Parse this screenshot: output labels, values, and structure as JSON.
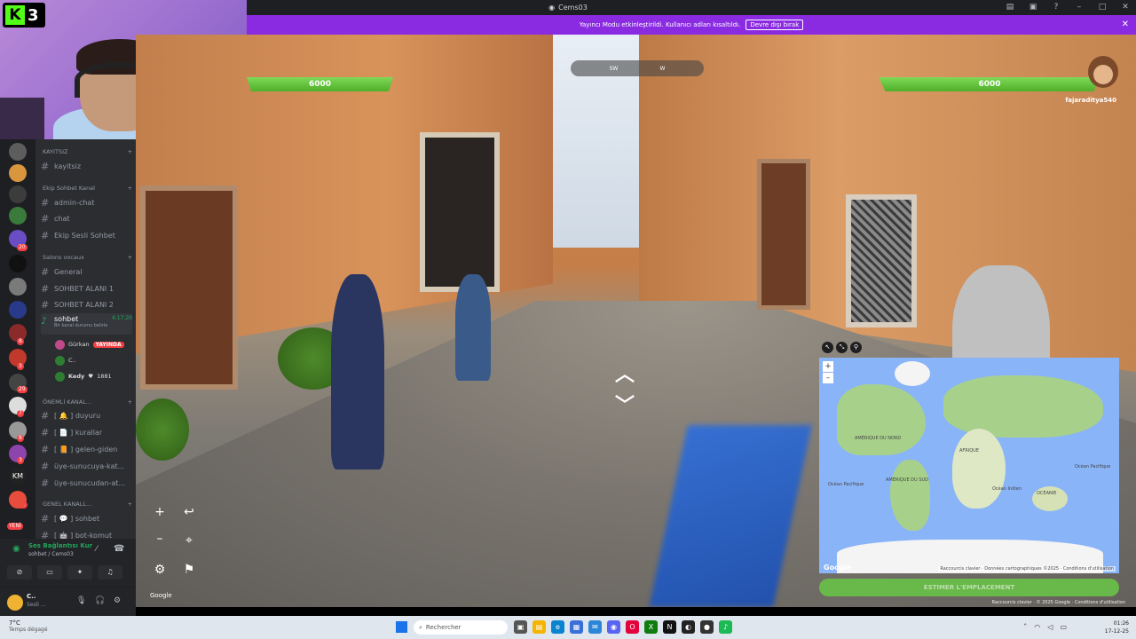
{
  "window": {
    "title": "Cems03"
  },
  "banner": {
    "message": "Yayıncı Modu etkinleştirildi. Kullanıcı adları kısaltıldı.",
    "button": "Devre dışı bırak"
  },
  "webcam": {
    "logo_number": "3"
  },
  "rail_badges": [
    "20",
    "8",
    "3",
    "29",
    "7",
    "8",
    "3",
    "22"
  ],
  "rail_new": "YENİ",
  "channels": {
    "cat1": "KAYITSIZ",
    "kayitsiz": "kayitsiz",
    "cat2": "Ekip Sohbet Kanal",
    "admin_chat": "admin-chat",
    "chat": "chat",
    "ekip_sesli": "Ekip Sesli Sohbet",
    "cat3": "Salons vocaux",
    "general": "General",
    "sohbet1": "SOHBET ALANI 1",
    "sohbet2": "SOHBET ALANI 2",
    "active": "sohbet",
    "active_time": "4:17:20",
    "active_status": "Bir kanal durumu belirle",
    "users": [
      {
        "name": "Gürkan",
        "badge": "YAYINDA"
      },
      {
        "name": "C.."
      },
      {
        "name": "Kedy",
        "extra": "1881"
      }
    ],
    "cat4": "ÖNEMLİ KANAL...",
    "duyuru": "[ 🔔 ] duyuru",
    "kurallar": "[ 📄 ] kurallar",
    "gelen": "[ 📙 ] gelen-giden",
    "uye1": "üye-sunucuya-kat...",
    "uye2": "üye-sunucudan-at...",
    "cat5": "GENEL KANALL...",
    "sohbet_txt": "[ 💬 ] sohbet",
    "bot": "[ 🤖 ] bot-komut"
  },
  "voice": {
    "status": "Ses Bağlantısı Kur",
    "sub": "sohbet / Cems03"
  },
  "user_panel": {
    "name": "C..",
    "status": "Sesli ..."
  },
  "game": {
    "hp_left": "6000",
    "hp_right": "6000",
    "compass_sw": "SW",
    "compass_w": "W",
    "player_tag": "fajaraditya540",
    "map_labels": [
      "AMÉRIQUE DU NORD",
      "AFRIQUE",
      "AMÉRIQUE DU SUD",
      "OCÉANIE",
      "Océan Pacifique",
      "Océan Indien",
      "Océan Pacifique"
    ],
    "map_attr": "Raccourcis clavier · Données cartographiques ©2025 · Conditions d'utilisation",
    "guess_btn": "ESTIMER L'EMPLACEMENT",
    "map_credit": "Raccourcis clavier · © 2025 Google · Conditions d'utilisation",
    "google": "Google"
  },
  "taskbar": {
    "weather_temp": "7°C",
    "weather_desc": "Temps dégagé",
    "search": "Rechercher",
    "time": "01:26",
    "date": "17-12-25"
  },
  "colors": {
    "banner": "#8a2be2",
    "hp": "#6ccf45",
    "map_water": "#8ab4f8",
    "land": "#a7d18a"
  }
}
